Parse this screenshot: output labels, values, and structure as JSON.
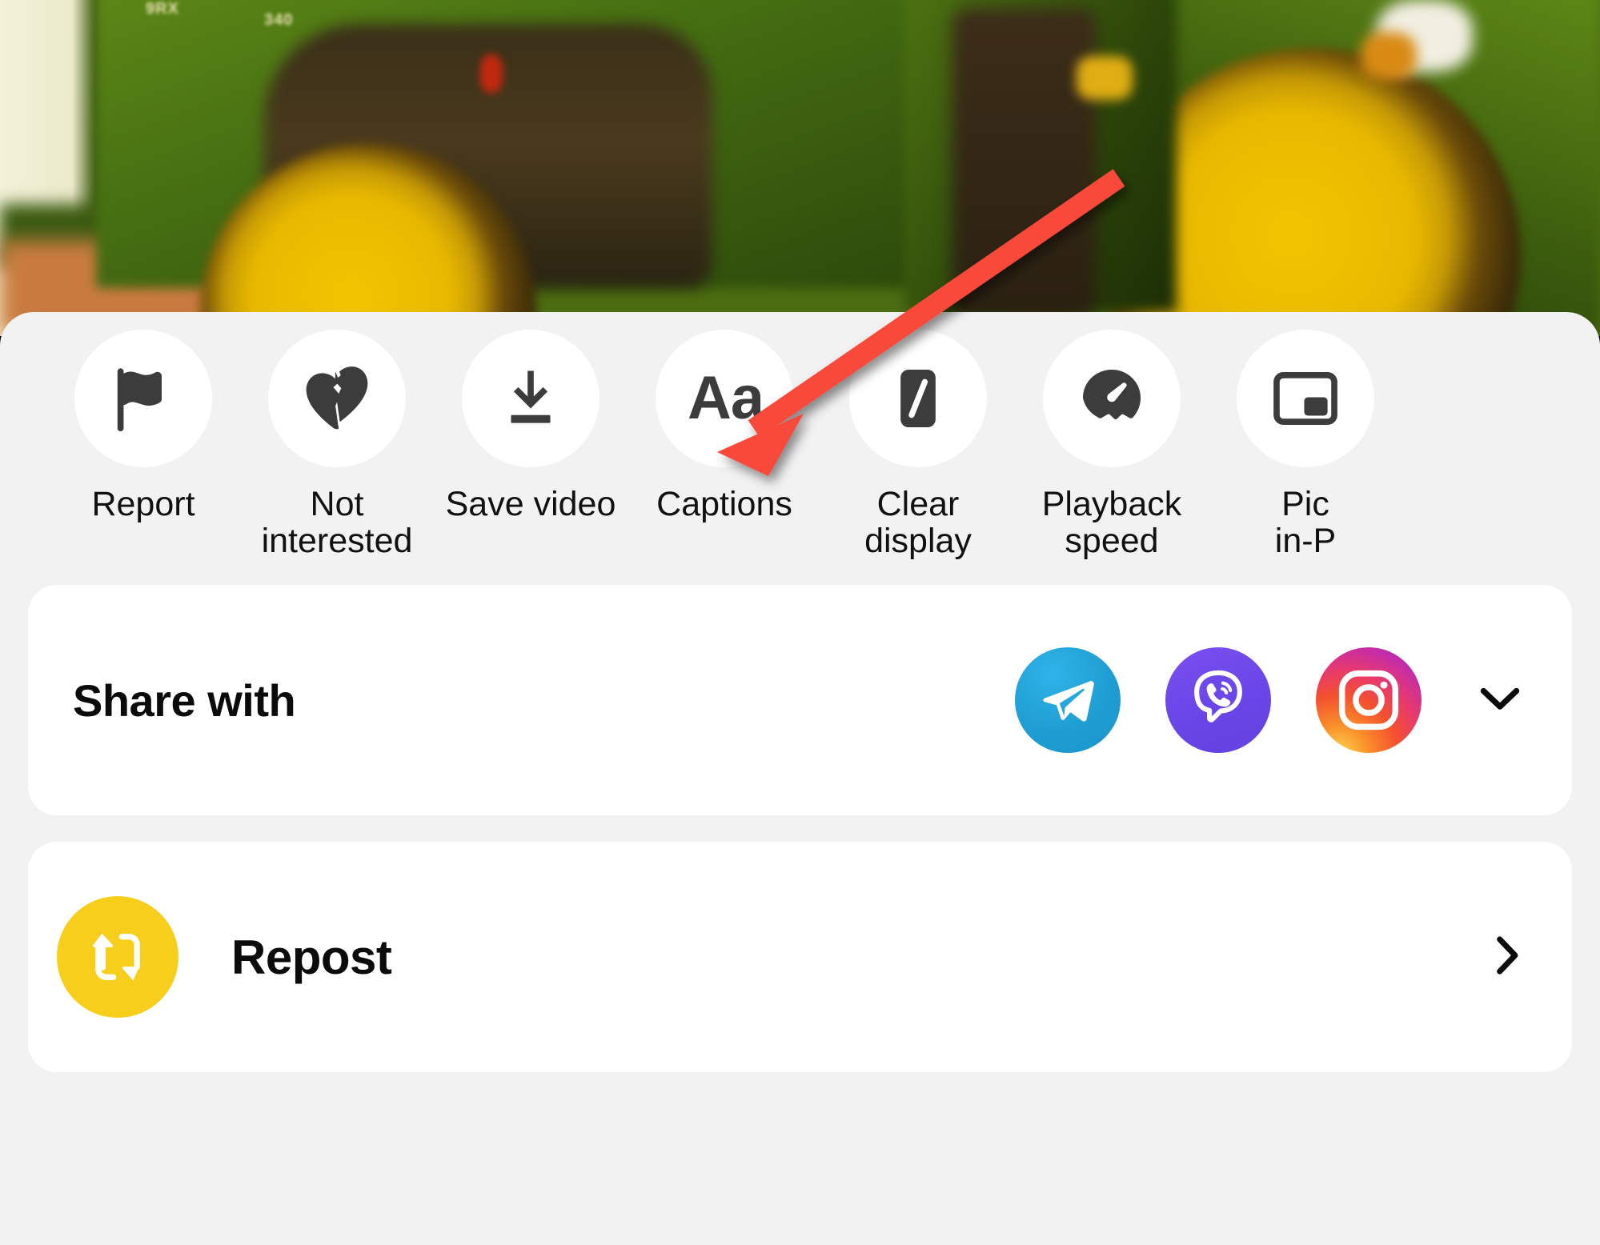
{
  "app": {
    "surface": "video-options-bottom-sheet",
    "sheet_bg": "#f2f2f2",
    "card_bg": "#ffffff",
    "icon_color": "#3c3c3c",
    "annotation_color": "#F9483A"
  },
  "video": {
    "description": "blurred green tractor with yellow wheels",
    "badge_1": "9RX",
    "badge_2": "340"
  },
  "actions": [
    {
      "label": "Report",
      "icon": "flag-icon"
    },
    {
      "label": "Not\ninterested",
      "icon": "broken-heart-icon"
    },
    {
      "label": "Save video",
      "icon": "download-icon"
    },
    {
      "label": "Captions",
      "icon": "aa-text-icon",
      "glyph": "Aa"
    },
    {
      "label": "Clear\ndisplay",
      "icon": "clear-display-icon"
    },
    {
      "label": "Playback\nspeed",
      "icon": "speedometer-icon"
    },
    {
      "label": "Pic\nin-P",
      "icon": "picture-in-picture-icon"
    }
  ],
  "share": {
    "title": "Share with",
    "targets": [
      {
        "name": "Telegram",
        "icon": "telegram-icon",
        "color": "#1f9ed3"
      },
      {
        "name": "Viber",
        "icon": "viber-icon",
        "color": "#6b46e8"
      },
      {
        "name": "Instagram",
        "icon": "instagram-icon",
        "color": "#e83a6b"
      }
    ],
    "expand_icon": "chevron-down-icon"
  },
  "repost": {
    "label": "Repost",
    "icon": "repost-icon",
    "icon_bg": "#F8CE1C",
    "chevron_icon": "chevron-right-icon"
  }
}
